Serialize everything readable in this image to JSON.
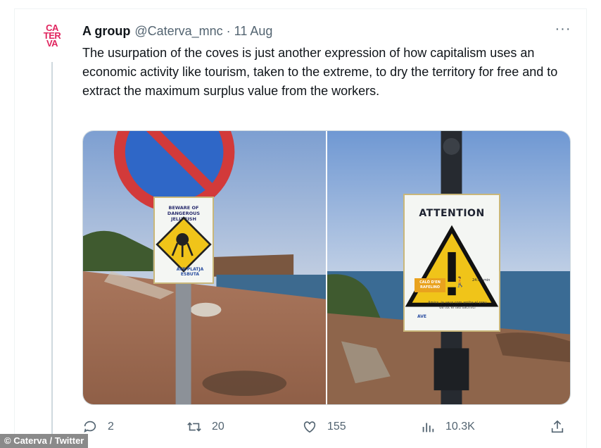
{
  "tweet": {
    "avatar_text": [
      "CA",
      "TER",
      "VA"
    ],
    "name": "A group",
    "handle": "@Caterva_mnc",
    "separator": "·",
    "date": "11 Aug",
    "more_label": "···",
    "text": "The usurpation of the coves is just another expression of how capitalism uses an economic activity like tourism, taken to the extreme, to dry the territory for free and to extract the maximum surplus value from the workers."
  },
  "media": {
    "photo1": {
      "sign_text": "BEWARE OF DANGEROUS JELLYFISH",
      "sign_logo": "AVE PLATJA ESBUTA"
    },
    "photo2": {
      "sign_title": "ATTENTION",
      "badge": "CALÓ D'EN RAFELINO",
      "hours": "24:55 min",
      "note": "Amics, ja veus com arriba el preu de tot el teu sacrifici",
      "sign_logo": "AVE"
    }
  },
  "actions": {
    "replies": "2",
    "retweets": "20",
    "likes": "155",
    "views": "10.3K"
  },
  "credit": "© Caterva / Twitter",
  "colors": {
    "text": "#0f1419",
    "secondary": "#536471",
    "border": "#cfd9de",
    "avatar": "#e0245e"
  }
}
